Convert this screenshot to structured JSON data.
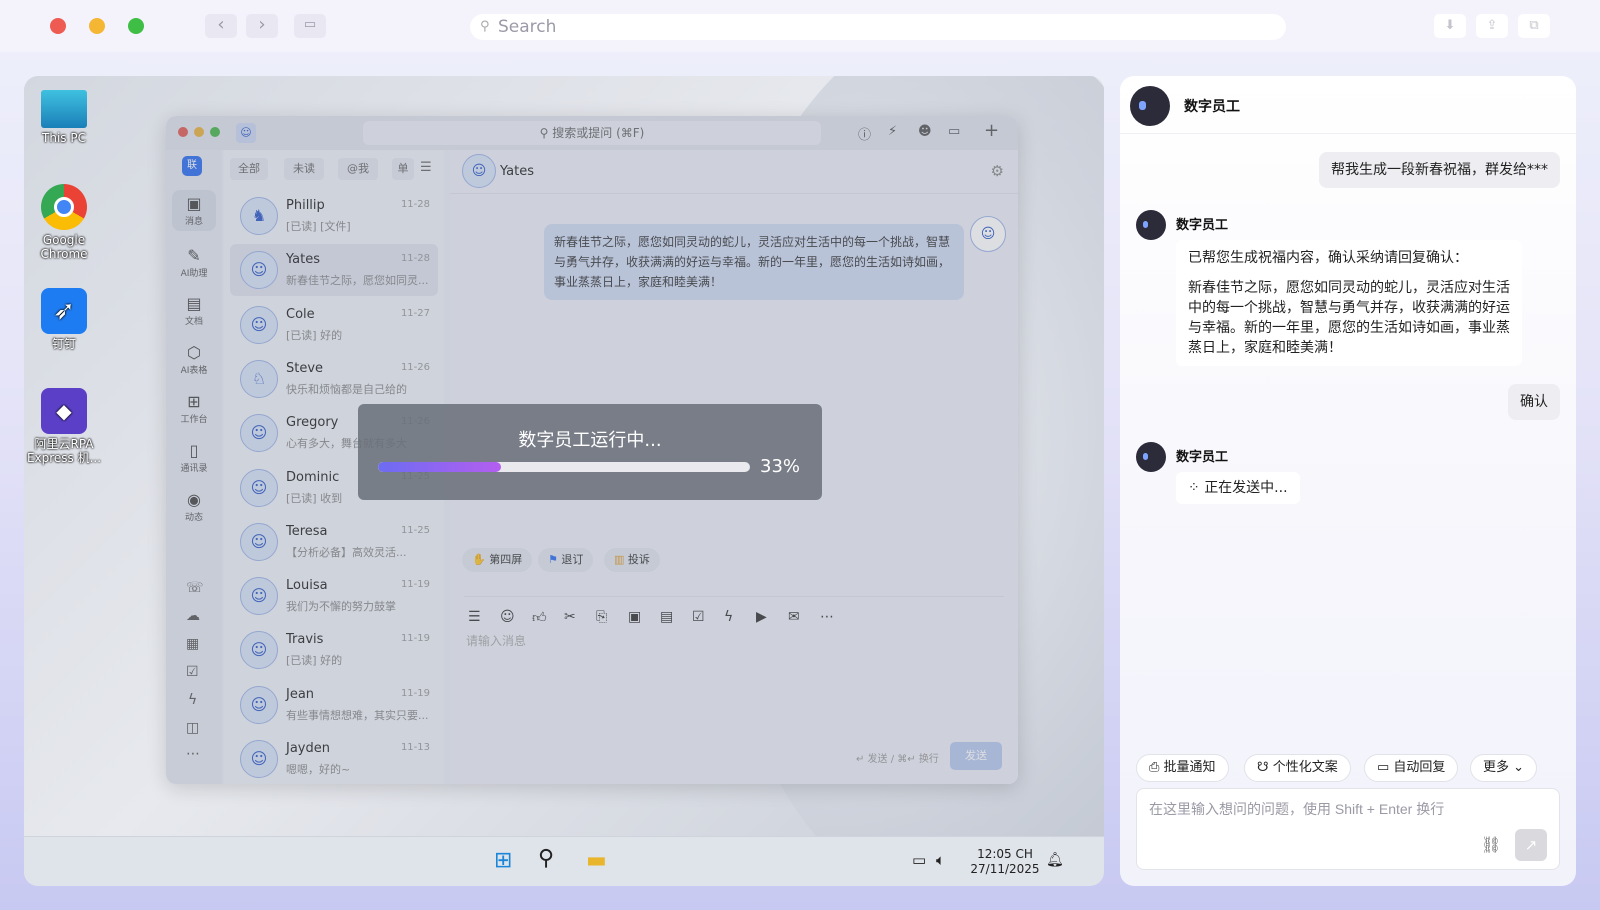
{
  "browser": {
    "traffic": [
      "#ee5b52",
      "#f5b733",
      "#3fbe45"
    ],
    "search_placeholder": "Search",
    "icons": [
      "back-icon",
      "forward-icon",
      "sidebar-icon",
      "download-icon",
      "share-icon",
      "tabs-icon"
    ]
  },
  "desktop": {
    "icons": [
      {
        "label": "This PC",
        "icon": "monitor-icon"
      },
      {
        "label": "Google Chrome",
        "icon": "chrome-icon"
      },
      {
        "label": "钉钉",
        "icon": "dingtalk-icon"
      },
      {
        "label": "阿里云RPA Express 机...",
        "icon": "rpa-icon"
      }
    ],
    "taskbar": {
      "time": "12:05 CH",
      "date": "27/11/2025"
    }
  },
  "dingtalk": {
    "search": "搜索或提问 (⌘F)",
    "side_badge": "联",
    "side_items": [
      {
        "label": "消息",
        "icon": "message-icon"
      },
      {
        "label": "AI助理",
        "icon": "ai-assistant-icon"
      },
      {
        "label": "文档",
        "icon": "doc-icon"
      },
      {
        "label": "AI表格",
        "icon": "ai-table-icon"
      },
      {
        "label": "工作台",
        "icon": "workbench-icon"
      },
      {
        "label": "通讯录",
        "icon": "contacts-icon"
      },
      {
        "label": "动态",
        "icon": "feed-icon"
      }
    ],
    "filters": [
      "全部",
      "未读",
      "@我",
      "单"
    ],
    "chats": [
      {
        "name": "Phillip",
        "date": "11-28",
        "preview": "[已读] [文件]"
      },
      {
        "name": "Yates",
        "date": "11-28",
        "preview": "新春佳节之际，愿您如同灵..."
      },
      {
        "name": "Cole",
        "date": "11-27",
        "preview": "[已读] 好的"
      },
      {
        "name": "Steve",
        "date": "11-26",
        "preview": "快乐和烦恼都是自己给的"
      },
      {
        "name": "Gregory",
        "date": "11-26",
        "preview": "心有多大，舞台就有多大"
      },
      {
        "name": "Dominic",
        "date": "11-25",
        "preview": "[已读] 收到"
      },
      {
        "name": "Teresa",
        "date": "11-25",
        "preview": "【分析必备】高效灵活..."
      },
      {
        "name": "Louisa",
        "date": "11-19",
        "preview": "我们为不懈的努力鼓掌"
      },
      {
        "name": "Travis",
        "date": "11-19",
        "preview": "[已读] 好的"
      },
      {
        "name": "Jean",
        "date": "11-19",
        "preview": "有些事情想想难，其实只要..."
      },
      {
        "name": "Jayden",
        "date": "11-13",
        "preview": "嗯嗯，好的~"
      }
    ],
    "current_chat": "Yates",
    "message": "新春佳节之际，愿您如同灵动的蛇儿，灵活应对生活中的每一个挑战，智慧与勇气并存，收获满满的好运与幸福。新的一年里，愿您的生活如诗如画，事业蒸蒸日上，家庭和睦美满！",
    "quick_chips": [
      "第四屏",
      "退订",
      "投诉"
    ],
    "input_placeholder": "请输入消息",
    "send_hint": "↵ 发送 / ⌘↵ 换行",
    "send_label": "发送"
  },
  "progress": {
    "title": "数字员工运行中...",
    "value": 0.33,
    "label": "33%"
  },
  "assistant": {
    "title": "数字员工",
    "user_msg_1": "帮我生成一段新春祝福，群发给***",
    "bot_name": "数字员工",
    "bot_reply_intro": "已帮您生成祝福内容，确认采纳请回复确认：",
    "bot_reply_body": "新春佳节之际，愿您如同灵动的蛇儿，灵活应对生活中的每一个挑战，智慧与勇气并存，收获满满的好运与幸福。新的一年里，愿您的生活如诗如画，事业蒸蒸日上，家庭和睦美满！",
    "user_msg_2": "确认",
    "sending": "正在发送中...",
    "chips": [
      "批量通知",
      "个性化文案",
      "自动回复",
      "更多"
    ],
    "input_placeholder": "在这里输入想问的问题，使用 Shift + Enter 换行"
  }
}
